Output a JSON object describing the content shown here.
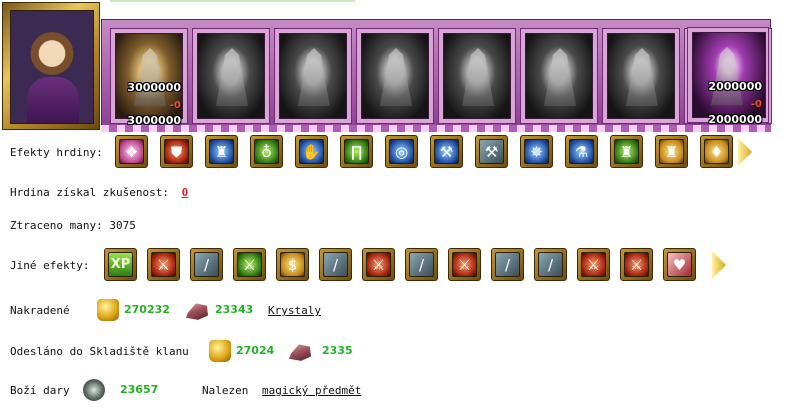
{
  "units": [
    {
      "name": "unit-1",
      "count_top": "3000000",
      "loss": "-0",
      "count_bottom": "3000000",
      "style": "color1"
    },
    {
      "name": "unit-2",
      "style": "gray"
    },
    {
      "name": "unit-3",
      "style": "gray"
    },
    {
      "name": "unit-4",
      "style": "gray"
    },
    {
      "name": "unit-5",
      "style": "gray"
    },
    {
      "name": "unit-6",
      "style": "gray"
    },
    {
      "name": "unit-7",
      "style": "gray"
    },
    {
      "name": "unit-8",
      "style": "gray"
    },
    {
      "name": "unit-9",
      "count_top": "2000000",
      "loss": "-0",
      "count_bottom": "2000000",
      "style": "color2"
    }
  ],
  "hero_effects": {
    "label": "Efekty hrdiny:",
    "icons": [
      "gift-box-icon",
      "shield-icon",
      "blue-armor-icon",
      "amulet-icon",
      "blue-gauntlet-icon",
      "green-boots-icon",
      "ring-icon",
      "ice-axe-icon",
      "war-hammer-icon",
      "ice-crystal-icon",
      "potion-icon",
      "green-armor-icon",
      "gold-armor-icon",
      "green-cloak-icon"
    ]
  },
  "experience": {
    "label": "Hrdina získal zkušenost:",
    "value": "0"
  },
  "mana": {
    "label": "Ztraceno many:",
    "value": "3075"
  },
  "other_effects": {
    "label": "Jiné efekty:",
    "icons": [
      "xp-bonus-icon",
      "fist-sword-icon",
      "sword-icon",
      "armored-sword-icon",
      "gold-pouch-icon",
      "sword-icon",
      "fist-sword-icon",
      "sword-icon",
      "fist-sword-icon",
      "sword-icon",
      "sword-icon",
      "fist-sword-icon",
      "fist-sword-icon",
      "heart-sword-icon"
    ],
    "xp_text": "XP"
  },
  "stolen": {
    "label": "Nakradené",
    "gold": "270232",
    "crystals": "23343",
    "link": "Krystaly"
  },
  "clan_storage": {
    "label": "Odesláno do Skladiště klanu",
    "gold": "27024",
    "crystals": "2335"
  },
  "gifts": {
    "label": "Boží dary",
    "value": "23657",
    "found_label": "Nalezen",
    "found_link": "magický předmět"
  },
  "colors": {
    "accent_red": "#e21b1b",
    "value_green": "#22b322",
    "unit_frame": "#b96bb8"
  }
}
